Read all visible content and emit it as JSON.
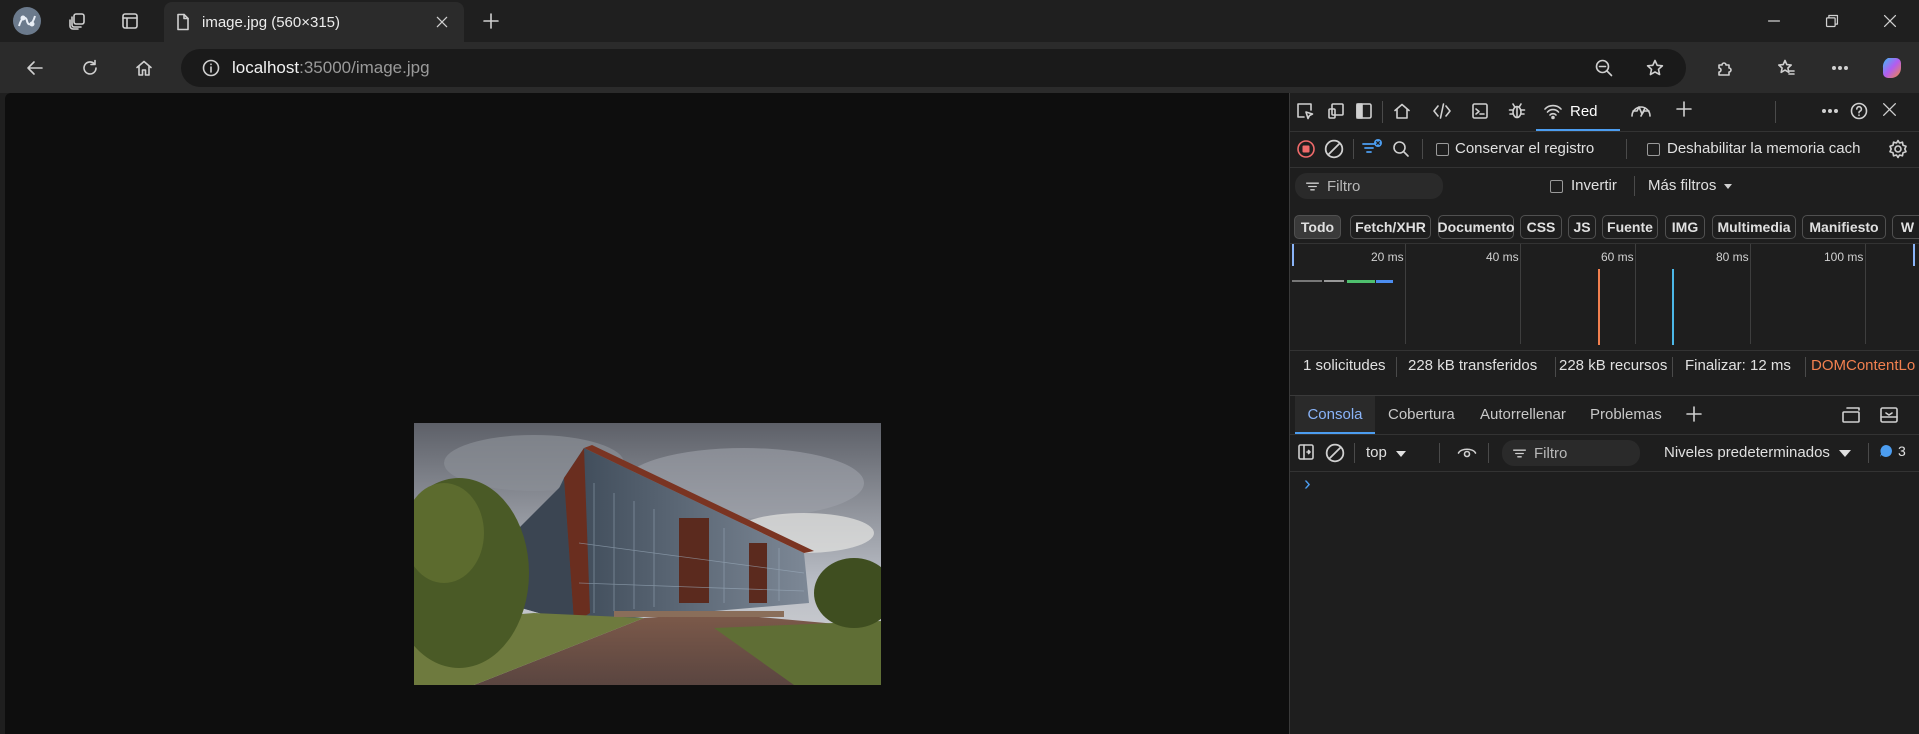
{
  "browser": {
    "tab_title": "image.jpg (560×315)",
    "address_host": "localhost",
    "address_path": ":35000/image.jpg"
  },
  "devtools": {
    "active_tool": "Red",
    "network": {
      "preserve_log": "Conservar el registro",
      "disable_cache": "Deshabilitar la memoria cach",
      "filter_placeholder": "Filtro",
      "invert": "Invertir",
      "more_filters": "Más filtros",
      "type_filters": [
        "Todo",
        "Fetch/XHR",
        "Documento",
        "CSS",
        "JS",
        "Fuente",
        "IMG",
        "Multimedia",
        "Manifiesto",
        "W"
      ],
      "timeline_ticks": [
        "20 ms",
        "40 ms",
        "60 ms",
        "80 ms",
        "100 ms"
      ],
      "summary": {
        "requests": "1 solicitudes",
        "transferred": "228 kB transferidos",
        "resources": "228 kB recursos",
        "finish": "Finalizar: 12 ms",
        "dom_content_loaded": "DOMContentLo"
      }
    },
    "drawer": {
      "tabs": [
        "Consola",
        "Cobertura",
        "Autorrellenar",
        "Problemas"
      ],
      "context": "top",
      "filter_placeholder": "Filtro",
      "levels": "Niveles predeterminados",
      "issues_count": "3",
      "prompt": "›"
    }
  },
  "colors": {
    "accent_blue": "#4c9df0",
    "record_red": "#f06a6a",
    "dcl_orange": "#f2804f"
  }
}
